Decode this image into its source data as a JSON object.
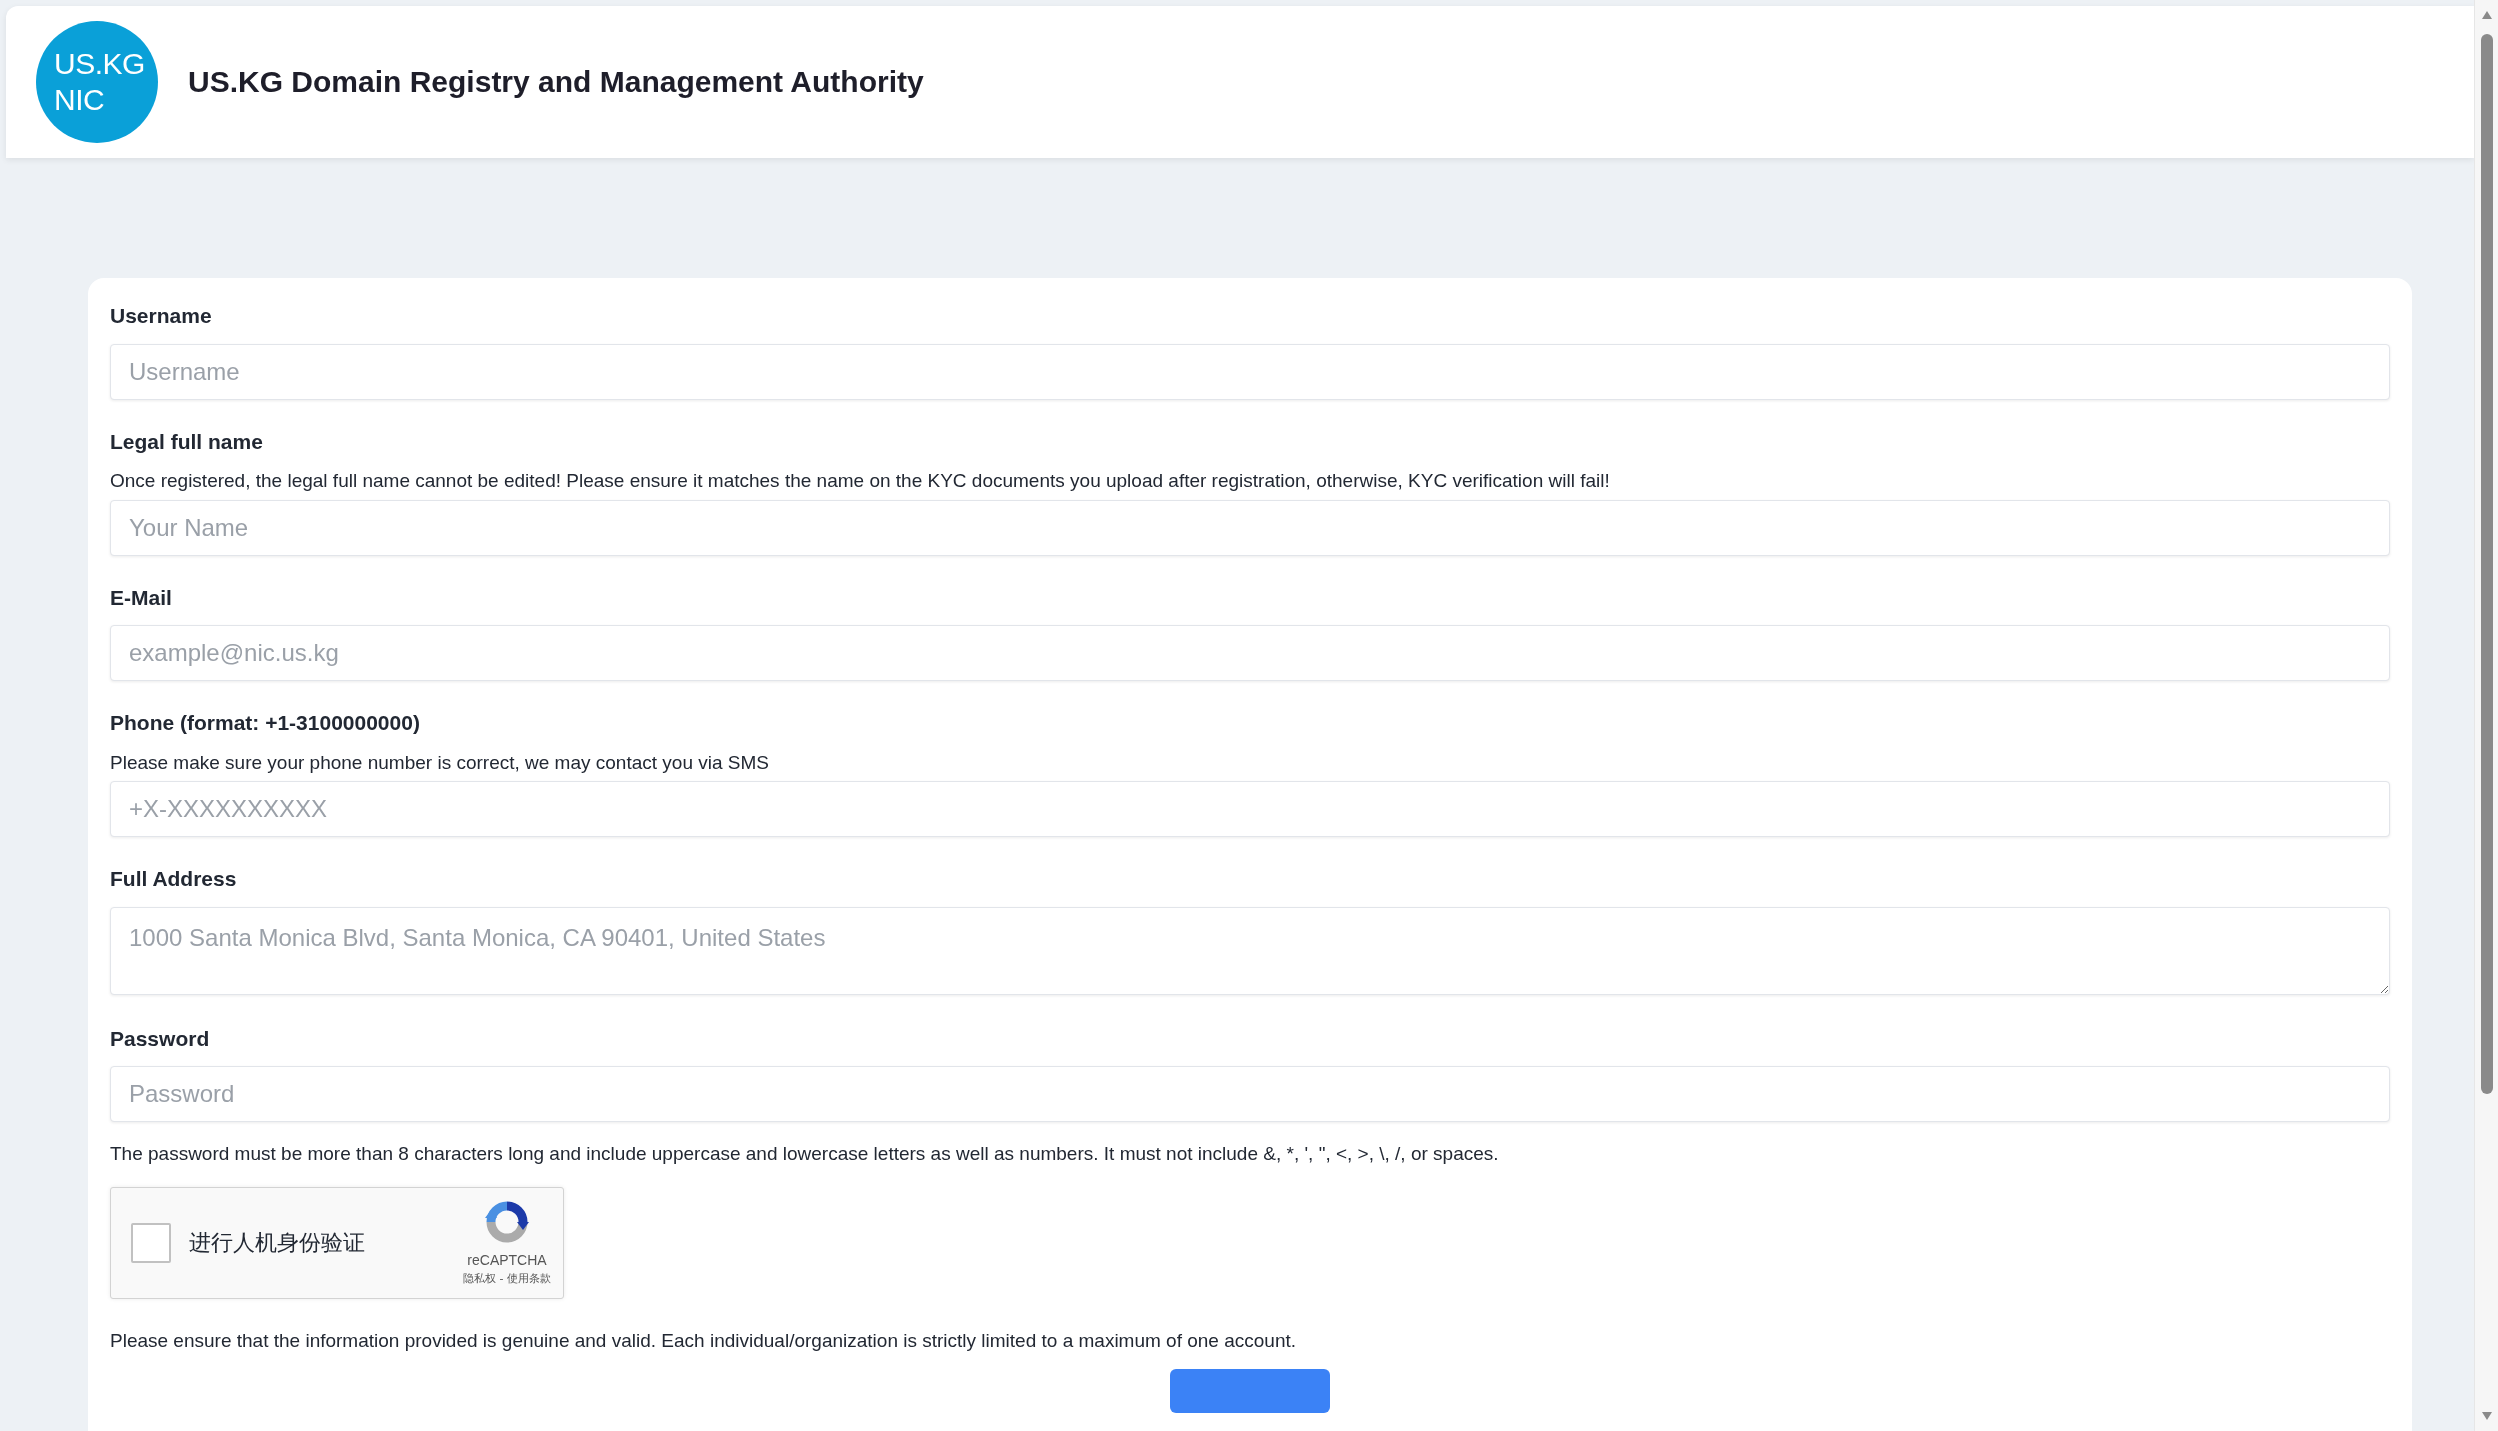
{
  "header": {
    "logo_lines": [
      "US.KG",
      "NIC"
    ],
    "title": "US.KG Domain Registry and Management Authority"
  },
  "fields": [
    {
      "kind": "input",
      "label": "Username",
      "placeholder": "Username"
    },
    {
      "kind": "input",
      "label": "Legal full name",
      "help": "Once registered, the legal full name cannot be edited! Please ensure it matches the name on the KYC documents you upload after registration, otherwise, KYC verification will fail!",
      "placeholder": "Your Name"
    },
    {
      "kind": "input",
      "label": "E-Mail",
      "placeholder": "example@nic.us.kg"
    },
    {
      "kind": "input",
      "label": "Phone (format: +1-3100000000)",
      "help": "Please make sure your phone number is correct, we may contact you via SMS",
      "placeholder": "+X-XXXXXXXXXX"
    },
    {
      "kind": "textarea",
      "label": "Full Address",
      "placeholder": "1000 Santa Monica Blvd, Santa Monica, CA 90401, United States"
    },
    {
      "kind": "input",
      "label": "Password",
      "placeholder": "Password",
      "note": "The password must be more than 8 characters long and include uppercase and lowercase letters as well as numbers. It must not include &, *, ', \", <, >, \\, /, or spaces."
    }
  ],
  "captcha": {
    "checked": false,
    "label": "进行人机身份验证",
    "brand": "reCAPTCHA",
    "links": [
      "隐私权",
      "使用条款"
    ],
    "separator": "-"
  },
  "notice": "Please ensure that the information provided is genuine and valid. Each individual/organization is strictly limited to a maximum of one account."
}
